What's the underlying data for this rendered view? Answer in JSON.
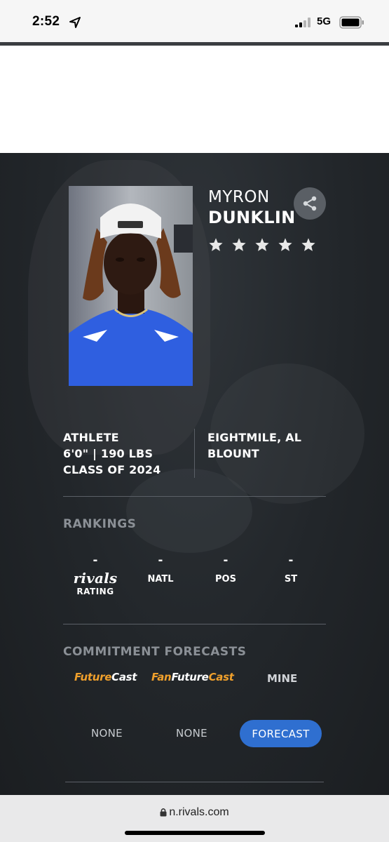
{
  "status": {
    "time": "2:52",
    "network": "5G"
  },
  "player": {
    "first_name": "MYRON",
    "last_name": "DUNKLIN",
    "star_rating": 5,
    "position": "ATHLETE",
    "size": "6'0\" | 190 LBS",
    "class": "CLASS OF 2024",
    "hometown": "EIGHTMILE, AL",
    "school": "BLOUNT"
  },
  "rankings": {
    "title": "RANKINGS",
    "rivals_value": "-",
    "rivals_logo": "rivals",
    "rivals_label": "RATING",
    "natl_value": "-",
    "natl_label": "NATL",
    "pos_value": "-",
    "pos_label": "POS",
    "st_value": "-",
    "st_label": "ST"
  },
  "forecasts": {
    "title": "COMMITMENT FORECASTS",
    "futurecast_a": "Future",
    "futurecast_b": "Cast",
    "fanfuturecast_a": "Fan",
    "fanfuturecast_b": "Future",
    "fanfuturecast_c": "Cast",
    "mine_label": "MINE",
    "futurecast_value": "NONE",
    "fanfuturecast_value": "NONE",
    "forecast_button": "FORECAST"
  },
  "browser": {
    "url": "n.rivals.com"
  },
  "colors": {
    "accent_blue": "#2f6fd0",
    "futurecast_orange": "#f0a02c",
    "background_dark": "#22262a"
  }
}
